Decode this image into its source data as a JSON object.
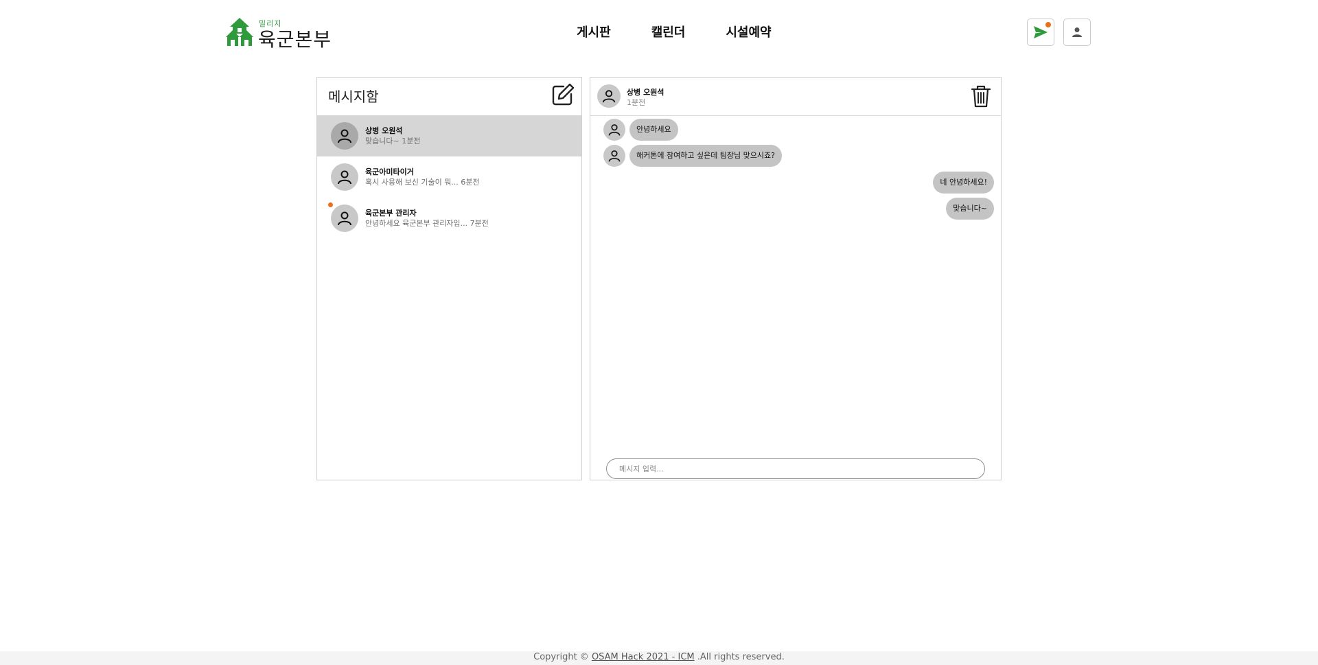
{
  "header": {
    "logo": {
      "sub": "밀리지",
      "main": "육군본부",
      "icon": "house-logo-icon"
    },
    "nav": [
      {
        "label": "게시판"
      },
      {
        "label": "캘린더"
      },
      {
        "label": "시설예약"
      }
    ],
    "buttons": {
      "messages": {
        "icon": "send-icon",
        "has_notification": true
      },
      "profile": {
        "icon": "person-icon"
      }
    }
  },
  "inbox": {
    "title": "메시지함",
    "compose_icon": "edit-icon",
    "conversations": [
      {
        "name": "상병 오원석",
        "preview": "맞습니다~ 1분전",
        "active": true,
        "unread": false
      },
      {
        "name": "육군아미타이거",
        "preview": "혹시 사용해 보신 기술이 뭐... 6분전",
        "active": false,
        "unread": false
      },
      {
        "name": "육군본부 관리자",
        "preview": "안녕하세요 육군본부 관리자입... 7분전",
        "active": false,
        "unread": true
      }
    ]
  },
  "chat": {
    "partner": {
      "name": "상병 오원석",
      "time": "1분전"
    },
    "delete_icon": "trash-icon",
    "messages": [
      {
        "direction": "in",
        "text": "안녕하세요"
      },
      {
        "direction": "in",
        "text": "해커톤에 참여하고 싶은데 팀장님 맞으시죠?"
      },
      {
        "direction": "out",
        "text": "네 안녕하세요!"
      },
      {
        "direction": "out",
        "text": "맞습니다~"
      }
    ],
    "input": {
      "placeholder": "메시지 입력...",
      "value": ""
    }
  },
  "footer": {
    "prefix": "Copyright © ",
    "link": "OSAM Hack 2021 - ICM",
    "suffix": " .All rights reserved."
  },
  "colors": {
    "brand_green": "#2e9a3c",
    "notification_orange": "#e8721c",
    "active_row": "#d6d6d6",
    "bubble": "#c4c4c4"
  }
}
